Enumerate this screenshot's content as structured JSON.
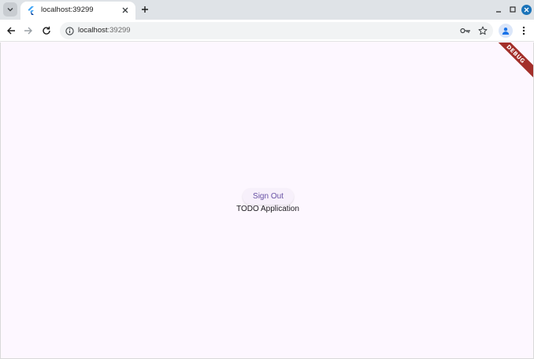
{
  "browser": {
    "tab": {
      "title": "localhost:39299"
    },
    "address_bar": {
      "host": "localhost",
      "port": ":39299"
    }
  },
  "app": {
    "debug_banner": "DEBUG",
    "sign_out_label": "Sign Out",
    "title": "TODO Application"
  },
  "colors": {
    "background": "#fdf7ff",
    "button_text": "#6750a4",
    "debug_banner": "#a32f2a",
    "window_close": "#1a73b9"
  }
}
